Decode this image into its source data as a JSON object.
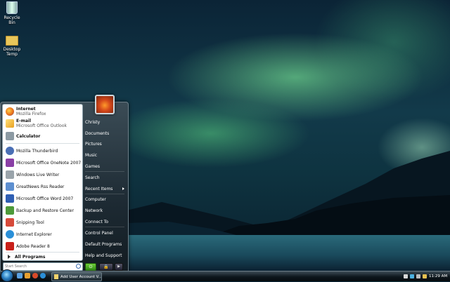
{
  "desktop": {
    "icons": [
      {
        "label": "Recycle Bin",
        "icon": "recycle-bin-icon"
      },
      {
        "label": "Desktop\nTemp",
        "line1": "Desktop",
        "line2": "Temp",
        "icon": "folder-icon"
      }
    ]
  },
  "start_menu": {
    "pinned": [
      {
        "title": "Internet",
        "subtitle": "Mozilla Firefox",
        "icon": "firefox-icon",
        "color": "#e66a1a"
      },
      {
        "title": "E-mail",
        "subtitle": "Microsoft Office Outlook",
        "icon": "outlook-icon",
        "color": "#e8b830"
      }
    ],
    "programs": [
      {
        "label": "Calculator",
        "icon": "calculator-icon",
        "color": "#8c9aa3"
      },
      {
        "label": "Mozilla Thunderbird",
        "icon": "thunderbird-icon",
        "color": "#4a6fb5"
      },
      {
        "label": "Microsoft Office OneNote 2007",
        "icon": "onenote-icon",
        "color": "#8a3fa6"
      },
      {
        "label": "Windows Live Writer",
        "icon": "live-writer-icon",
        "color": "#9aa4ab"
      },
      {
        "label": "GreatNews Rss Reader",
        "icon": "rss-reader-icon",
        "color": "#5d8fd0"
      },
      {
        "label": "Microsoft Office Word 2007",
        "icon": "word-icon",
        "color": "#2f5fb3"
      },
      {
        "label": "Backup and Restore Center",
        "icon": "backup-icon",
        "color": "#4d9a3a"
      },
      {
        "label": "Snipping Tool",
        "icon": "snipping-tool-icon",
        "color": "#d64a3a"
      },
      {
        "label": "Internet Explorer",
        "icon": "internet-explorer-icon",
        "color": "#2a8fd8"
      },
      {
        "label": "Adobe Reader 8",
        "icon": "adobe-reader-icon",
        "color": "#c8201a"
      }
    ],
    "all_programs_label": "All Programs",
    "search_placeholder": "Start Search",
    "right_items": [
      {
        "label": "Christy"
      },
      {
        "label": "Documents"
      },
      {
        "label": "Pictures"
      },
      {
        "label": "Music"
      },
      {
        "label": "Games"
      },
      {
        "label": "Search"
      },
      {
        "label": "Recent Items",
        "submenu": true
      },
      {
        "label": "Computer"
      },
      {
        "label": "Network"
      },
      {
        "label": "Connect To"
      },
      {
        "label": "Control Panel"
      },
      {
        "label": "Default Programs"
      },
      {
        "label": "Help and Support"
      }
    ],
    "power_icon": "power-icon",
    "lock_icon": "lock-icon"
  },
  "taskbar": {
    "task_button_label": "Add User Account V...",
    "clock": "11:29 AM"
  },
  "colors": {
    "taskbar": "#0d161c",
    "start_menu": "#1d2a33",
    "aurora": "#78e696"
  }
}
